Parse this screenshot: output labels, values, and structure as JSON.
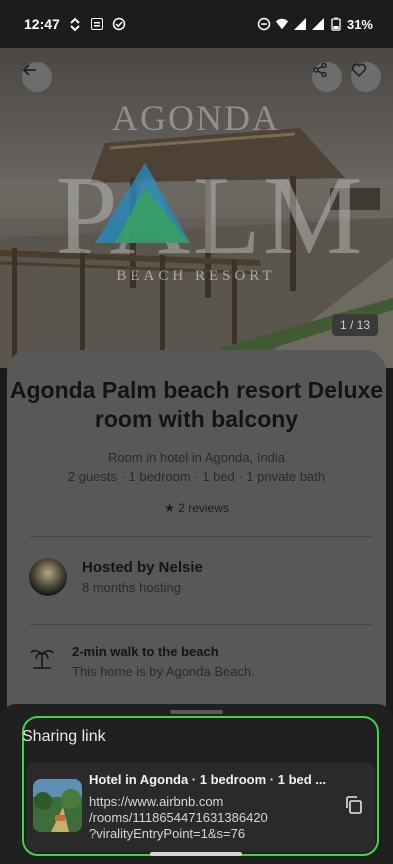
{
  "status_bar": {
    "time": "12:47",
    "battery": "31%",
    "icons": [
      "hotspot-icon",
      "calendar-icon",
      "check-circle-icon",
      "dnd-icon",
      "wifi-icon",
      "signal-icon",
      "signal-icon",
      "battery-icon"
    ]
  },
  "hero": {
    "photo_counter": "1 / 13",
    "logo_top_text": "AGONDA",
    "logo_main_text": "PALM",
    "logo_bottom_text": "BEACH RESORT"
  },
  "listing": {
    "title": "Agonda Palm beach resort Deluxe room with balcony",
    "subtitle": "Room in hotel in Agonda, India",
    "details": "2 guests · 1 bedroom · 1 bed · 1 private bath",
    "reviews": "2 reviews",
    "host_name": "Hosted by Nelsie",
    "host_duration": "8 months hosting",
    "feature_title": "2-min walk to the beach",
    "feature_sub": "This home is by Agonda Beach."
  },
  "share_sheet": {
    "title": "Sharing link",
    "link_title": "Hotel in Agonda · 1 bedroom · 1 bed ...",
    "link_url": "https://www.airbnb.com\n/rooms/1118654471631386420\n?viralityEntryPoint=1&s=76"
  },
  "colors": {
    "highlight": "#3cd64a",
    "sheet_background": "#202020",
    "overlay_background": "#585858"
  }
}
